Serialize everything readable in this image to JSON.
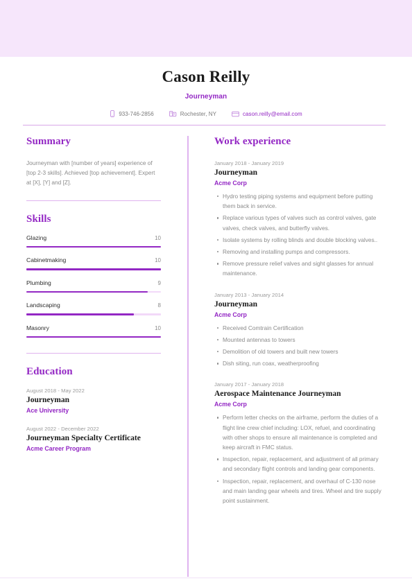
{
  "theme": {
    "banner_color": "#f6e6fb",
    "accent_color": "#9327c4",
    "rule_color": "#dfb3ef",
    "body_text_color": "#8a8a8a"
  },
  "header": {
    "full_name": "Cason Reilly",
    "job_title": "Journeyman",
    "contacts": [
      {
        "icon": "phone-icon",
        "value": "933-746-2856"
      },
      {
        "icon": "location-building-icon",
        "value": "Rochester, NY"
      },
      {
        "icon": "email-envelope-icon",
        "value": "cason.reilly@email.com"
      }
    ]
  },
  "left_column": {
    "summary": {
      "heading": "Summary",
      "text": "Journeyman with [number of years] experience of [top 2-3 skills]. Achieved [top achievement]. Expert at [X], [Y] and [Z]."
    },
    "skills": {
      "heading": "Skills",
      "max": 10,
      "items": [
        {
          "name": "Glazing",
          "value": "10",
          "pct": 100
        },
        {
          "name": "Cabinetmaking",
          "value": "10",
          "pct": 100
        },
        {
          "name": "Plumbing",
          "value": "9",
          "pct": 90
        },
        {
          "name": "Landscaping",
          "value": "8",
          "pct": 80
        },
        {
          "name": "Masonry",
          "value": "10",
          "pct": 100
        }
      ]
    },
    "education": {
      "heading": "Education",
      "entries": [
        {
          "date": "August 2018 - May 2022",
          "title": "Journeyman",
          "org": "Ace University"
        },
        {
          "date": "August 2022 - December 2022",
          "title": "Journeyman Specialty Certificate",
          "org": "Acme Career Program"
        }
      ]
    }
  },
  "right_column": {
    "work_experience": {
      "heading": "Work experience",
      "entries": [
        {
          "date": "January 2018 - January 2019",
          "title": "Journeyman",
          "org": "Acme Corp",
          "bullets": [
            "Hydro testing piping systems and equipment before putting them back in service.",
            "Replace various types of valves such as control valves, gate valves, check valves, and butterfly valves.",
            "Isolate systems by rolling blinds and double blocking valves..",
            "Removing and installing pumps and compressors.",
            "Remove pressure relief valves and sight glasses for annual maintenance."
          ]
        },
        {
          "date": "January 2013 - January 2014",
          "title": "Journeyman",
          "org": "Acme Corp",
          "bullets": [
            "Received Comtrain Certification",
            "Mounted antennas to towers",
            "Demolition of old towers and built new towers",
            "Dish siting, run coax, weatherproofing"
          ]
        },
        {
          "date": "January 2017 - January 2018",
          "title": "Aerospace Maintenance Journeyman",
          "org": "Acme Corp",
          "bullets": [
            "Perform letter checks on the airframe, perform the duties of a flight line crew chief including: LOX, refuel, and coordinating with other shops to ensure all maintenance is completed and keep aircraft in FMC status.",
            "Inspection, repair, replacement, and adjustment of all primary and secondary flight controls and landing gear components.",
            "Inspection, repair, replacement, and overhaul of C-130 nose and main landing gear wheels and tires. Wheel and tire supply point sustainment."
          ]
        }
      ]
    }
  }
}
